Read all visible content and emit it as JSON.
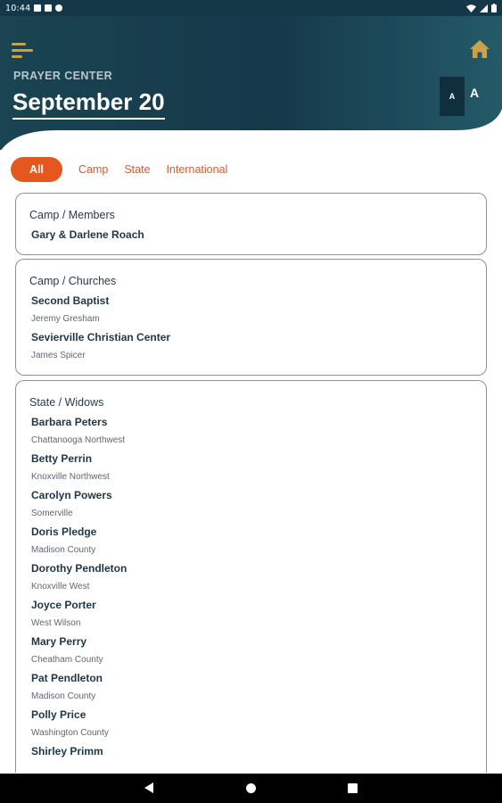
{
  "status_bar": {
    "time": "10:44",
    "icons": [
      "notification-icon",
      "sim-icon",
      "sync-icon",
      "wifi-icon",
      "signal-icon",
      "battery-icon"
    ]
  },
  "header": {
    "eyebrow": "PRAYER CENTER",
    "date": "September 20",
    "font_small": "A",
    "font_large": "A",
    "menu_icon": "menu-icon",
    "home_icon": "home-icon"
  },
  "colors": {
    "header_bg": "#143848",
    "accent": "#e4571e",
    "gold": "#c9a24a"
  },
  "filters": [
    "All",
    "Camp",
    "State",
    "International"
  ],
  "selected_filter": "All",
  "cards": [
    {
      "title": "Camp / Members",
      "entries": [
        {
          "name": "Gary & Darlene Roach",
          "sub": ""
        }
      ]
    },
    {
      "title": "Camp / Churches",
      "entries": [
        {
          "name": "Second Baptist",
          "sub": "Jeremy Gresham"
        },
        {
          "name": "Sevierville Christian Center",
          "sub": "James Spicer"
        }
      ]
    },
    {
      "title": "State / Widows",
      "entries": [
        {
          "name": "Barbara Peters",
          "sub": "Chattanooga Northwest"
        },
        {
          "name": "Betty Perrin",
          "sub": "Knoxville Northwest"
        },
        {
          "name": "Carolyn Powers",
          "sub": "Somerville"
        },
        {
          "name": "Doris Pledge",
          "sub": "Madison County"
        },
        {
          "name": "Dorothy Pendleton",
          "sub": "Knoxville West"
        },
        {
          "name": "Joyce Porter",
          "sub": "West Wilson"
        },
        {
          "name": "Mary Perry",
          "sub": "Cheatham County"
        },
        {
          "name": "Pat Pendleton",
          "sub": "Madison County"
        },
        {
          "name": "Polly Price",
          "sub": "Washington County"
        },
        {
          "name": "Shirley Primm",
          "sub": ""
        }
      ]
    }
  ],
  "nav": {
    "back_icon": "back-icon",
    "home_icon": "home-circle-icon",
    "recents_icon": "recents-icon"
  }
}
